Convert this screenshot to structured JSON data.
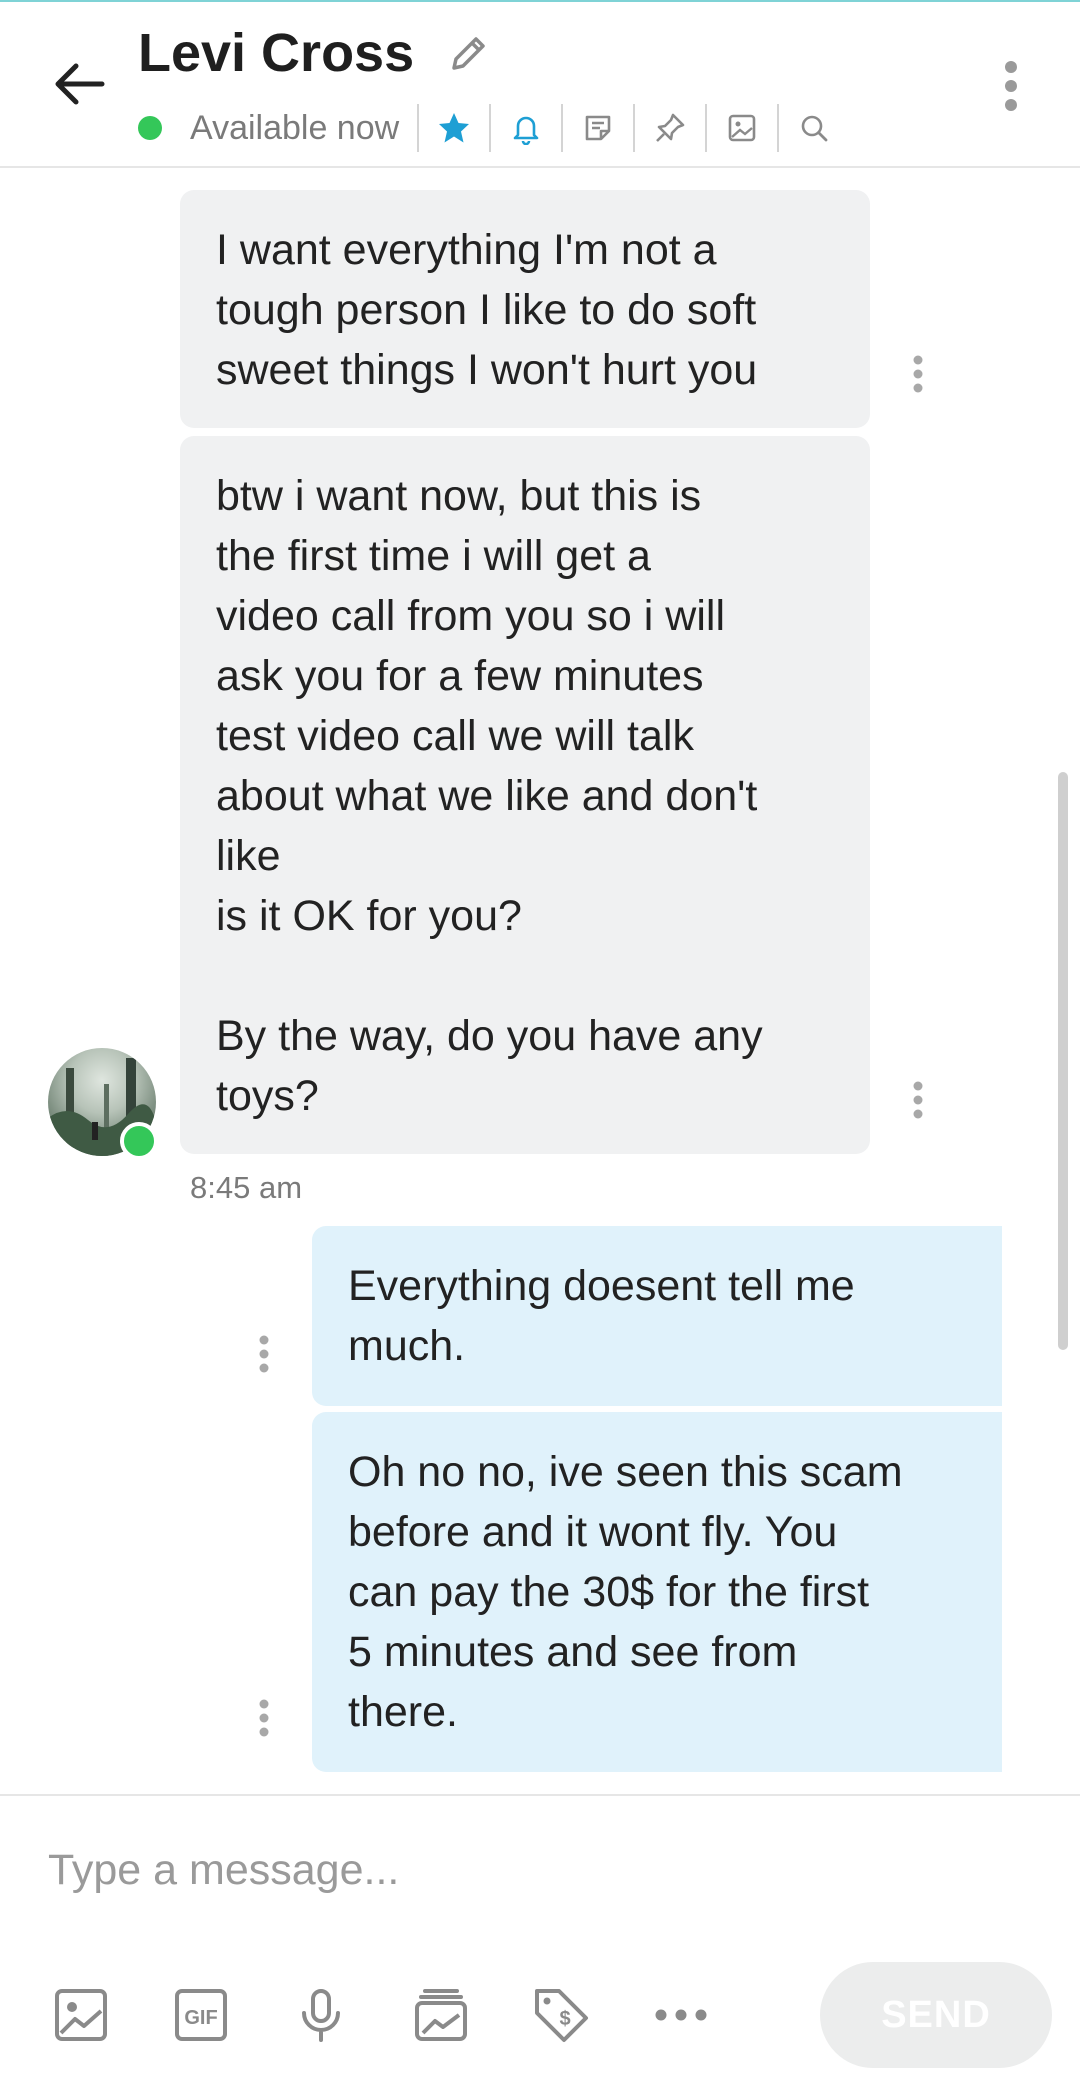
{
  "header": {
    "contact_name": "Levi Cross",
    "status_text": "Available now",
    "icons": [
      "back-arrow-icon",
      "pencil-icon",
      "star-icon",
      "bell-icon",
      "note-icon",
      "pin-icon",
      "image-icon",
      "search-icon",
      "more-vertical-icon"
    ],
    "colors": {
      "accent": "#1e9fd4",
      "online": "#34c759",
      "inactive_icon": "#8a8a8a"
    }
  },
  "messages": [
    {
      "direction": "incoming",
      "text": "I want everything I'm not a\ntough person I like to do soft\nsweet things I won't hurt you"
    },
    {
      "direction": "incoming",
      "text": "btw i want now, but this is\nthe first time i will get a\nvideo call from you so i will\nask you for a few minutes\ntest video call we will talk\nabout what we like and don't\nlike\nis it OK for you?\n\nBy the way, do you have any\ntoys?"
    },
    {
      "direction": "outgoing",
      "text": "Everything doesent tell me\nmuch."
    },
    {
      "direction": "outgoing",
      "text": "Oh no no, ive seen this scam\nbefore and it wont fly. You\ncan pay the 30$ for the first\n5 minutes and see from\nthere."
    }
  ],
  "timestamp": "8:45 am",
  "composer": {
    "placeholder": "Type a message...",
    "send_label": "SEND",
    "toolbar_icons": [
      "image-icon",
      "gif-icon",
      "microphone-icon",
      "album-icon",
      "price-tag-icon",
      "more-horizontal-icon"
    ]
  },
  "colors": {
    "incoming_bubble": "#f0f1f2",
    "outgoing_bubble": "#e0f2fb",
    "send_button_disabled": "#eceded"
  }
}
